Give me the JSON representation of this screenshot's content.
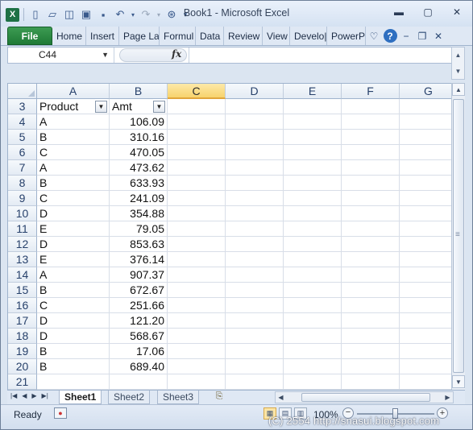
{
  "titlebar": {
    "title": "Book1  -  Microsoft Excel",
    "qat_icons": [
      "excel-logo-icon",
      "new-icon",
      "open-icon",
      "folder-icon",
      "picture-icon",
      "save-icon",
      "undo-icon",
      "redo-icon",
      "zoom-icon",
      "customize-icon"
    ],
    "logo_letter": "X"
  },
  "ribbon": {
    "file_label": "File",
    "tabs": [
      "Home",
      "Insert",
      "Page La",
      "Formul",
      "Data",
      "Review",
      "View",
      "Develo|",
      "PowerP"
    ]
  },
  "formula_bar": {
    "name_box": "C44",
    "fx_label": "fx",
    "formula": ""
  },
  "grid": {
    "columns": [
      "A",
      "B",
      "C",
      "D",
      "E",
      "F",
      "G"
    ],
    "selected_column": "C",
    "header_row": {
      "row": "3",
      "a": "Product",
      "b": "Amt"
    },
    "rows": [
      {
        "row": "4",
        "a": "A",
        "b": "106.09"
      },
      {
        "row": "5",
        "a": "B",
        "b": "310.16"
      },
      {
        "row": "6",
        "a": "C",
        "b": "470.05"
      },
      {
        "row": "7",
        "a": "A",
        "b": "473.62"
      },
      {
        "row": "8",
        "a": "B",
        "b": "633.93"
      },
      {
        "row": "9",
        "a": "C",
        "b": "241.09"
      },
      {
        "row": "10",
        "a": "D",
        "b": "354.88"
      },
      {
        "row": "11",
        "a": "E",
        "b": "79.05"
      },
      {
        "row": "12",
        "a": "D",
        "b": "853.63"
      },
      {
        "row": "13",
        "a": "E",
        "b": "376.14"
      },
      {
        "row": "14",
        "a": "A",
        "b": "907.37"
      },
      {
        "row": "15",
        "a": "B",
        "b": "672.67"
      },
      {
        "row": "16",
        "a": "C",
        "b": "251.66"
      },
      {
        "row": "17",
        "a": "D",
        "b": "121.20"
      },
      {
        "row": "18",
        "a": "D",
        "b": "568.67"
      },
      {
        "row": "19",
        "a": "B",
        "b": "17.06"
      },
      {
        "row": "20",
        "a": "B",
        "b": "689.40"
      },
      {
        "row": "21",
        "a": "",
        "b": ""
      }
    ]
  },
  "sheets": {
    "tabs": [
      "Sheet1",
      "Sheet2",
      "Sheet3"
    ],
    "active": "Sheet1"
  },
  "status": {
    "ready": "Ready",
    "zoom": "100%",
    "zoom_level": 0.5
  },
  "watermark": "(C) 2554 http://snasui.blogspot.com",
  "colors": {
    "file_tab": "#1f7a36",
    "selected_header": "#f7d36c"
  }
}
